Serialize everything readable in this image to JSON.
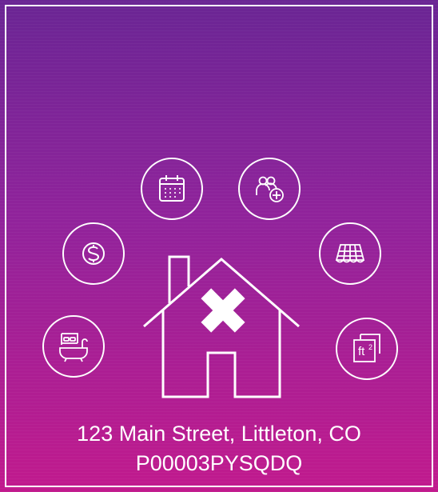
{
  "listing": {
    "address": "123 Main Street, Littleton, CO",
    "property_id": "P00003PYSQDQ"
  },
  "icons": {
    "calendar": "calendar-icon",
    "people_add": "people-add-icon",
    "price": "dollar-icon",
    "roof": "roof-icon",
    "bed_bath": "bed-bath-icon",
    "area": "square-feet-icon",
    "area_label": "ft",
    "area_superscript": "2",
    "house": "house-unavailable-icon"
  },
  "colors": {
    "gradient_top": "#6a2594",
    "gradient_bottom": "#c11a8d",
    "foreground": "#ffffff"
  }
}
